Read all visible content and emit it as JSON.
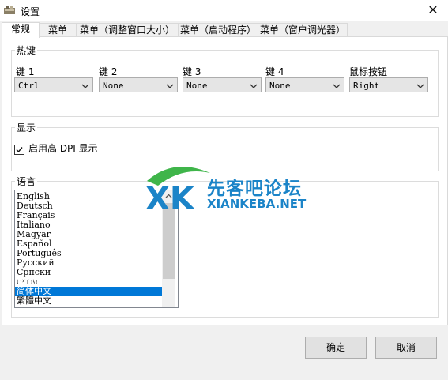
{
  "window": {
    "title": "设置",
    "close_glyph": "✕"
  },
  "tabs": [
    {
      "label": "常规"
    },
    {
      "label": "菜单"
    },
    {
      "label": "菜单（调整窗口大小）"
    },
    {
      "label": "菜单（启动程序）"
    },
    {
      "label": "菜单（窗户调光器）"
    }
  ],
  "hotkeys": {
    "title": "热键",
    "fields": [
      {
        "label": "键 1",
        "value": "Ctrl"
      },
      {
        "label": "键 2",
        "value": "None"
      },
      {
        "label": "键 3",
        "value": "None"
      },
      {
        "label": "键 4",
        "value": "None"
      },
      {
        "label": "鼠标按钮",
        "value": "Right"
      }
    ]
  },
  "display": {
    "title": "显示",
    "dpi_label": "启用高 DPI 显示",
    "dpi_checked": true
  },
  "language": {
    "title": "语言",
    "items": [
      "English",
      "Deutsch",
      "Français",
      "Italiano",
      "Magyar",
      "Español",
      "Português",
      "Русский",
      "Српски",
      "עברית",
      "简体中文",
      "繁體中文"
    ],
    "selected": "简体中文"
  },
  "buttons": {
    "ok": "确定",
    "cancel": "取消"
  },
  "watermark": {
    "cn": "先客吧论坛",
    "en": "XIANKEBA.NET",
    "logo": "XK"
  },
  "colors": {
    "selection": "#0078d7",
    "watermark_blue": "#1b84c8",
    "watermark_green": "#3fb54a"
  }
}
